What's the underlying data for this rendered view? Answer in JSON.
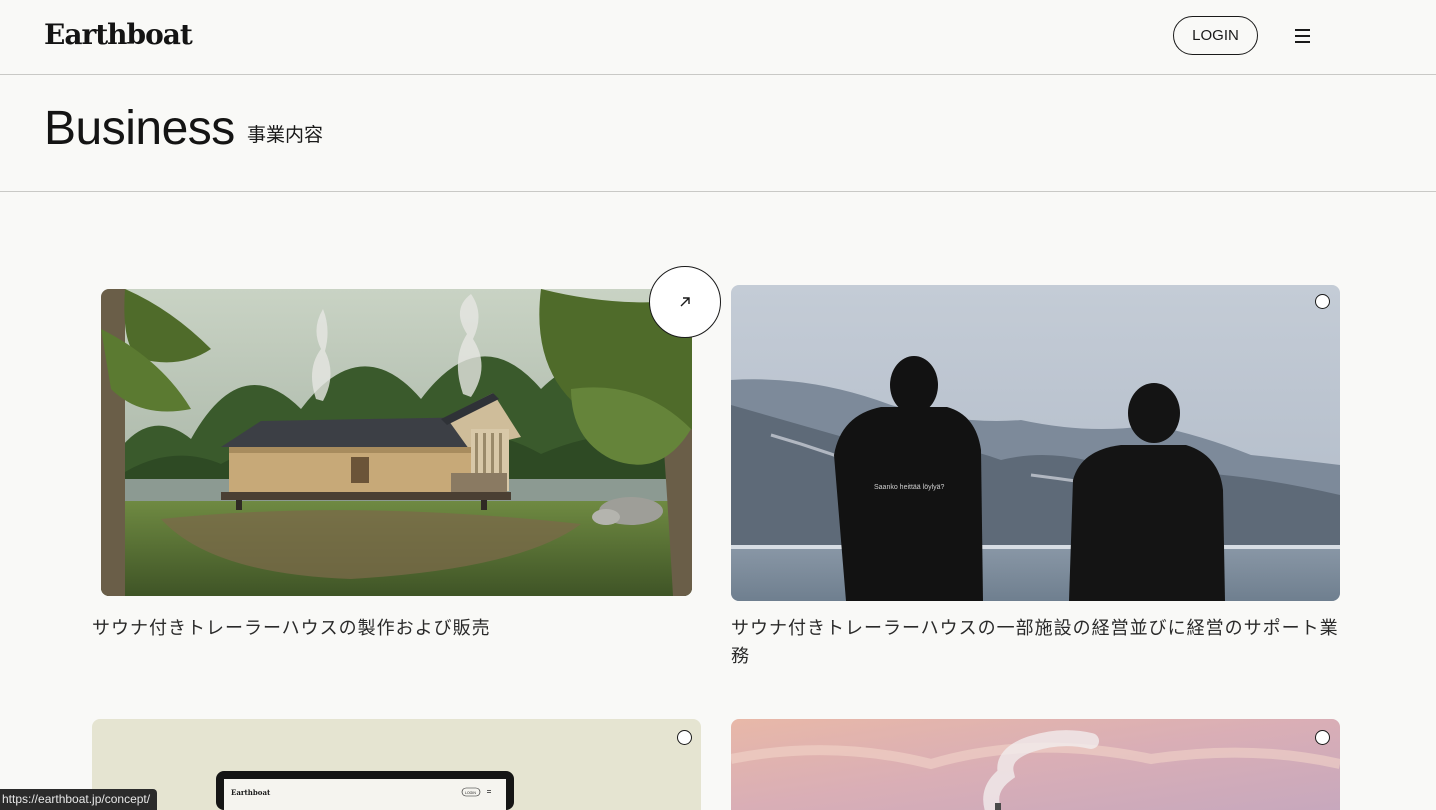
{
  "header": {
    "logo": "Earthboat",
    "login_label": "LOGIN",
    "menu_icon": "hamburger-menu-icon"
  },
  "page": {
    "title": "Business",
    "subtitle": "事業内容"
  },
  "cards": [
    {
      "title": "サウナ付きトレーラーハウスの製作および販売",
      "image": "wooden-trailer-sauna-in-forest",
      "hovered": true
    },
    {
      "title": "サウナ付きトレーラーハウスの一部施設の経営並びに経営のサポート業務",
      "image": "two-people-facing-snowy-mountains-and-lake",
      "hoodie_text": "Saanko heittää löylyä?"
    },
    {
      "title": "",
      "image": "laptop-showing-earthboat-site",
      "laptop_logo": "Earthboat",
      "laptop_login": "LOGIN"
    },
    {
      "title": "",
      "image": "pink-sky-with-sauna-smoke"
    }
  ],
  "status_bar": {
    "url": "https://earthboat.jp/concept/"
  },
  "colors": {
    "background": "#f9f9f7",
    "text": "#1a1a1a",
    "divider": "#c9c9c6"
  }
}
